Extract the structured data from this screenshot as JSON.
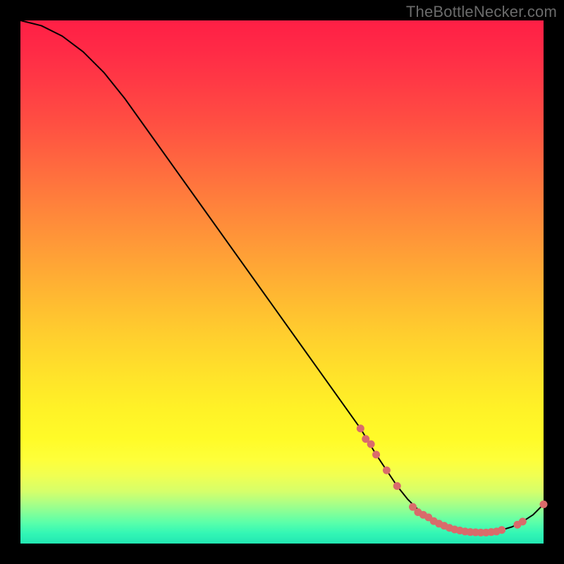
{
  "attribution": "TheBottleNecker.com",
  "chart_data": {
    "type": "line",
    "title": "",
    "xlabel": "",
    "ylabel": "",
    "xlim": [
      0,
      100
    ],
    "ylim": [
      0,
      100
    ],
    "series": [
      {
        "name": "bottleneck-curve",
        "x": [
          0,
          4,
          8,
          12,
          16,
          20,
          25,
          30,
          35,
          40,
          45,
          50,
          55,
          60,
          65,
          68,
          70,
          72,
          74,
          76,
          78,
          80,
          82,
          84,
          86,
          88,
          90,
          92,
          94,
          96,
          98,
          100
        ],
        "values": [
          100,
          99,
          97,
          94,
          90,
          85,
          78,
          71,
          64,
          57,
          50,
          43,
          36,
          29,
          22,
          17,
          14,
          11,
          8.5,
          6.5,
          5,
          3.8,
          3,
          2.5,
          2.2,
          2.1,
          2.2,
          2.6,
          3.2,
          4.2,
          5.5,
          7.5
        ]
      }
    ],
    "points": {
      "name": "highlighted-points",
      "x": [
        65,
        66,
        67,
        68,
        70,
        72,
        75,
        76,
        77,
        78,
        79,
        80,
        81,
        82,
        83,
        84,
        85,
        86,
        87,
        88,
        89,
        90,
        91,
        92,
        95,
        96,
        100
      ],
      "values": [
        22,
        20,
        19,
        17,
        14,
        11,
        7,
        6,
        5.5,
        5,
        4.3,
        3.8,
        3.4,
        3,
        2.7,
        2.5,
        2.3,
        2.2,
        2.15,
        2.1,
        2.1,
        2.2,
        2.3,
        2.6,
        3.6,
        4.2,
        7.5
      ]
    }
  }
}
